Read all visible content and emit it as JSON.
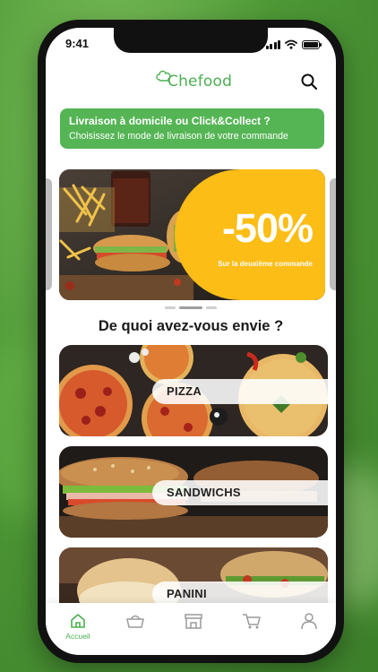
{
  "status_bar": {
    "time": "9:41"
  },
  "header": {
    "logo_text": "Chefood",
    "logo_icon": "chef-hat-icon",
    "search_icon": "search-icon"
  },
  "delivery_card": {
    "title": "Livraison à domicile ou Click&Collect ?",
    "subtitle": "Choisissez le mode de livraison de votre commande"
  },
  "promo_banner": {
    "value": "-50%",
    "caption": "Sur la deuxième commande"
  },
  "carousel": {
    "page_count": 3,
    "active_index": 1
  },
  "section_title": "De quoi avez-vous envie ?",
  "categories": [
    {
      "label": "PIZZA"
    },
    {
      "label": "SANDWICHS"
    },
    {
      "label": "PANINI"
    }
  ],
  "tab_bar": {
    "tabs": [
      {
        "label": "Accueil",
        "icon": "home-icon",
        "active": true
      },
      {
        "label": "",
        "icon": "basket-icon",
        "active": false
      },
      {
        "label": "",
        "icon": "store-icon",
        "active": false
      },
      {
        "label": "",
        "icon": "cart-icon",
        "active": false
      },
      {
        "label": "",
        "icon": "user-icon",
        "active": false
      }
    ]
  },
  "colors": {
    "brand_green": "#55b555",
    "promo_yellow": "#fbbd16",
    "background_green": "#4f9a37"
  }
}
